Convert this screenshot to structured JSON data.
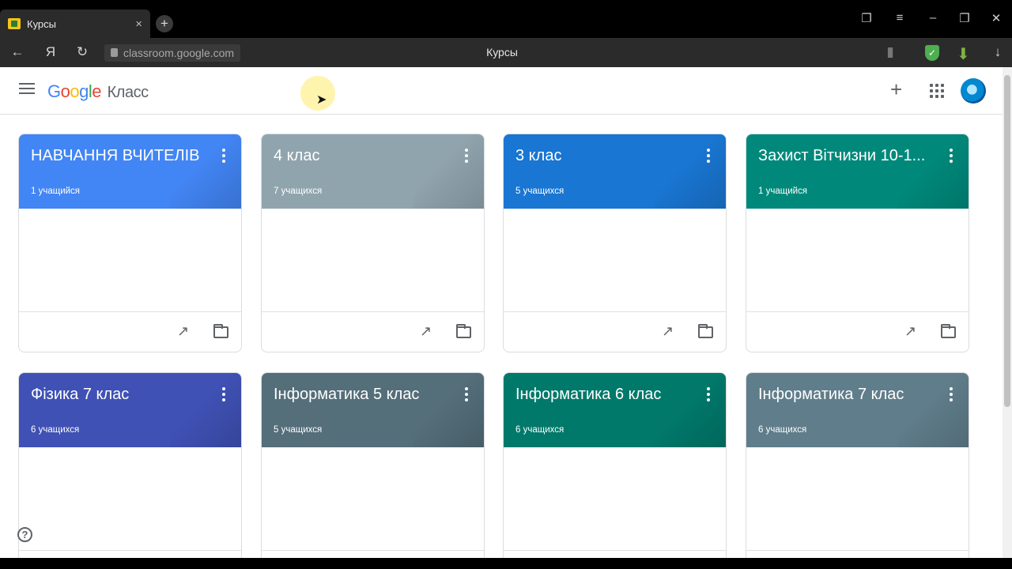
{
  "browser": {
    "tab_title": "Курсы",
    "tab_close": "×",
    "new_tab": "+",
    "url": "classroom.google.com",
    "page_title": "Курсы",
    "yandex": "Я"
  },
  "app": {
    "logo_google": [
      "G",
      "o",
      "o",
      "g",
      "l",
      "e"
    ],
    "logo_product": "Класс",
    "create_label": "+",
    "help_label": "?"
  },
  "courses": [
    {
      "title": "НАВЧАННЯ ВЧИТЕЛІВ",
      "students": "1 учащийся",
      "color": "#4285f4"
    },
    {
      "title": "4 клас",
      "students": "7 учащихся",
      "color": "#90a4ae"
    },
    {
      "title": "3 клас",
      "students": "5 учащихся",
      "color": "#1976d2"
    },
    {
      "title": "Захист Вітчизни 10-1...",
      "students": "1 учащийся",
      "color": "#00897b"
    },
    {
      "title": "Фізика 7 клас",
      "students": "6 учащихся",
      "color": "#3f51b5"
    },
    {
      "title": "Інформатика 5 клас",
      "students": "5 учащихся",
      "color": "#546e7a"
    },
    {
      "title": "Інформатика 6 клас",
      "students": "6 учащихся",
      "color": "#00796b"
    },
    {
      "title": "Інформатика 7 клас",
      "students": "6 учащихся",
      "color": "#607d8b"
    }
  ]
}
